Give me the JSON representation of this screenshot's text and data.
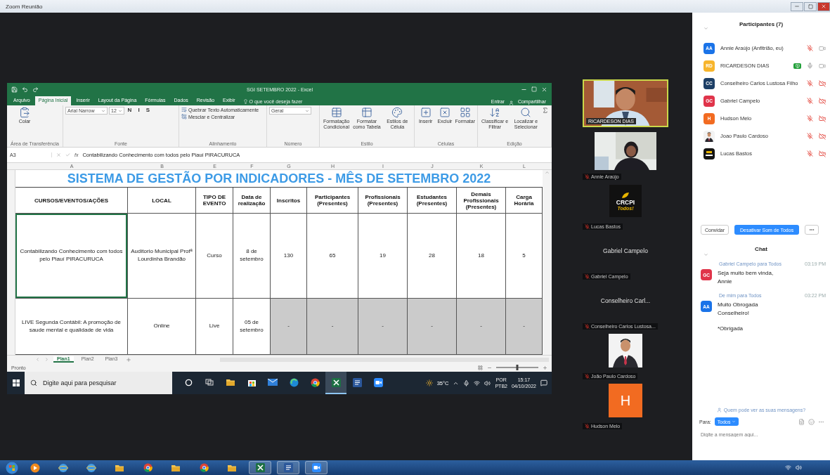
{
  "window": {
    "title": "Zoom Reunião"
  },
  "excel": {
    "title": "SGI SETEMBRO 2022 - Excel",
    "tabs": [
      {
        "label": "Arquivo",
        "selected": false
      },
      {
        "label": "Página Inicial",
        "selected": true
      },
      {
        "label": "Inserir",
        "selected": false
      },
      {
        "label": "Layout da Página",
        "selected": false
      },
      {
        "label": "Fórmulas",
        "selected": false
      },
      {
        "label": "Dados",
        "selected": false
      },
      {
        "label": "Revisão",
        "selected": false
      },
      {
        "label": "Exibir",
        "selected": false
      }
    ],
    "tell_me": "O que você deseja fazer",
    "sign_in": "Entrar",
    "share": "Compartilhar",
    "ribbon": [
      {
        "name": "Área de Transferência",
        "items": [
          {
            "kind": "large",
            "label": "Colar"
          }
        ]
      },
      {
        "name": "Fonte",
        "items": [
          {
            "kind": "dropdown",
            "label": "Arial Narrow"
          },
          {
            "kind": "dropdown",
            "label": "12"
          },
          {
            "kind": "letter",
            "label": "N"
          },
          {
            "kind": "letter",
            "label": "I"
          },
          {
            "kind": "letter",
            "label": "S"
          }
        ]
      },
      {
        "name": "Alinhamento",
        "items": [
          {
            "kind": "small",
            "label": "Quebrar Texto Automaticamente"
          },
          {
            "kind": "small",
            "label": "Mesclar e Centralizar"
          }
        ]
      },
      {
        "name": "Número",
        "items": [
          {
            "kind": "dropdown",
            "label": "Geral"
          }
        ]
      },
      {
        "name": "Estilo",
        "items": [
          {
            "kind": "large",
            "label": "Formatação Condicional"
          },
          {
            "kind": "large",
            "label": "Formatar como Tabela"
          },
          {
            "kind": "large",
            "label": "Estilos de Célula"
          }
        ]
      },
      {
        "name": "Células",
        "items": [
          {
            "kind": "large",
            "label": "Inserir"
          },
          {
            "kind": "large",
            "label": "Excluir"
          },
          {
            "kind": "large",
            "label": "Formatar"
          }
        ]
      },
      {
        "name": "Edição",
        "items": [
          {
            "kind": "large",
            "label": "Classificar e Filtrar"
          },
          {
            "kind": "large",
            "label": "Localizar e Selecionar"
          }
        ]
      }
    ],
    "name_box": "A3",
    "function_label": "fx",
    "formula": "Contabilizando Conhecimento com todos pelo Piauí PIRACURUCA",
    "column_letters": [
      "A",
      "B",
      "E",
      "F",
      "G",
      "H",
      "I",
      "J",
      "K",
      "L"
    ],
    "sheet_title": "SISTEMA DE GESTÃO POR INDICADORES - MÊS DE SETEMBRO 2022",
    "columns": [
      "CURSOS/EVENTOS/AÇÕES",
      "LOCAL",
      "TIPO DE EVENTO",
      "Data de realização",
      "Inscritos",
      "Participantes (Presentes)",
      "Profissionais (Presentes)",
      "Estudantes (Presentes)",
      "Demais Profissionais (Presentes)",
      "Carga Horária"
    ],
    "rows": [
      {
        "active_cell": true,
        "shaded": false,
        "cells": [
          "Contabilizando Conhecimento com todos pelo Piauí PIRACURUCA",
          "Auditorio Municipal Profª Lourdinha Brandão",
          "Curso",
          "8 de setembro",
          "130",
          "65",
          "19",
          "28",
          "18",
          "5"
        ]
      },
      {
        "active_cell": false,
        "shaded": true,
        "cells": [
          "LIVE Segunda Contábil: A promoção de saude mental e qualidade de vida",
          "Online",
          "Live",
          "05 de setembro",
          "-",
          "-",
          "-",
          "-",
          "-",
          "-"
        ]
      }
    ],
    "sheets": [
      {
        "label": "Plan1",
        "selected": true
      },
      {
        "label": "Plan2",
        "selected": false
      },
      {
        "label": "Plan3",
        "selected": false
      }
    ],
    "status": "Pronto",
    "zoom": {
      "level": 0.5
    }
  },
  "desktop_taskbar": {
    "search": {
      "placeholder": "Digite aqui para pesquisar"
    },
    "apps": [
      {
        "kind": "cortana",
        "active": false
      },
      {
        "kind": "taskview",
        "active": false
      },
      {
        "kind": "folder",
        "active": false
      },
      {
        "kind": "store",
        "active": false
      },
      {
        "kind": "mail",
        "active": false
      },
      {
        "kind": "edge",
        "active": false
      },
      {
        "kind": "chrome",
        "active": false
      },
      {
        "kind": "excel",
        "active": true
      },
      {
        "kind": "word",
        "active": false
      },
      {
        "kind": "zoom",
        "active": false
      }
    ],
    "weather": "35°C",
    "language": [
      "POR",
      "PTB2"
    ],
    "time": "15:17",
    "date": "04/10/2022"
  },
  "videos": [
    {
      "kind": "camera",
      "name": "RICARDESON DIAS",
      "muted": false,
      "speaking": true
    },
    {
      "kind": "camera",
      "name": "Annie Araújo",
      "muted": true,
      "speaking": false
    },
    {
      "kind": "logo",
      "logo_text": "CRCPI",
      "logo_tag": "Todos!",
      "name": "Lucas Bastos",
      "muted": true,
      "speaking": false
    },
    {
      "kind": "name",
      "display": "Gabriel Campelo",
      "name": "Gabriel Campelo",
      "muted": true,
      "speaking": false
    },
    {
      "kind": "name",
      "display": "Conselheiro  Carl...",
      "name": "Conselheiro Carlos Lustosa...",
      "muted": true,
      "speaking": false
    },
    {
      "name": "João Paulo Cardoso",
      "muted": true,
      "speaking": false
    },
    {
      "kind": "initial",
      "initial": "H",
      "color": "#f26b21",
      "name": "Hudson Melo",
      "muted": true,
      "speaking": false
    }
  ],
  "participants": {
    "title": "Participantes (7)",
    "items": [
      {
        "kind": "initials",
        "initials": "AA",
        "color": "#1a73e8",
        "name": "Annie Araújo (Anfitrião, eu)",
        "sharing": false,
        "muted": true,
        "video_off": false
      },
      {
        "kind": "initials",
        "initials": "RD",
        "color": "#f7b52c",
        "name": "RICARDESON DIAS",
        "sharing": true,
        "muted": false,
        "video_off": false
      },
      {
        "kind": "initials",
        "initials": "CC",
        "color": "#1d3f66",
        "name": "Conselheiro Carlos Lustosa Filho",
        "sharing": false,
        "muted": true,
        "video_off": true
      },
      {
        "kind": "initials",
        "initials": "GC",
        "color": "#e0344a",
        "name": "Gabriel Campelo",
        "sharing": false,
        "muted": true,
        "video_off": true
      },
      {
        "kind": "initials",
        "initials": "H",
        "color": "#f26b21",
        "name": "Hudson Melo",
        "sharing": false,
        "muted": true,
        "video_off": true
      },
      {
        "kind": "picture",
        "name": "Joao Paulo Cardoso",
        "sharing": false,
        "muted": true,
        "video_off": true
      },
      {
        "kind": "logo",
        "name": "Lucas Bastos",
        "sharing": false,
        "muted": true,
        "video_off": true
      }
    ],
    "buttons": [
      "Convidar",
      "Desativar Som de Todos"
    ]
  },
  "chat": {
    "title": "Chat",
    "messages": [
      {
        "sender": "Gabriel Campelo para Todos",
        "time": "03:19 PM",
        "initials": "GC",
        "color": "#e0344a",
        "texts": [
          "Seja muito bem vinda, Annie"
        ]
      },
      {
        "sender": "De mim para Todos",
        "time": "03:22 PM",
        "initials": "AA",
        "color": "#1a73e8",
        "texts": [
          "Muito Obrogada Conselheiro!",
          "*Obrigada"
        ]
      }
    ],
    "privacy": "Quem pode ver as suas mensagens?",
    "to_label": "Para:",
    "to": "Todos",
    "input": {
      "placeholder": "Digite a mensagem aqui..."
    }
  },
  "os_taskbar": {
    "apps": [
      {
        "kind": "media",
        "active": false
      },
      {
        "kind": "ie",
        "active": false
      },
      {
        "kind": "ie",
        "active": false
      },
      {
        "kind": "folder",
        "active": false
      },
      {
        "kind": "chrome",
        "active": false
      },
      {
        "kind": "folder",
        "active": false
      },
      {
        "kind": "chrome",
        "active": false
      },
      {
        "kind": "folder",
        "active": false
      },
      {
        "kind": "excel",
        "active": true
      },
      {
        "kind": "word",
        "active": true
      },
      {
        "kind": "zoom",
        "active": true
      }
    ]
  }
}
